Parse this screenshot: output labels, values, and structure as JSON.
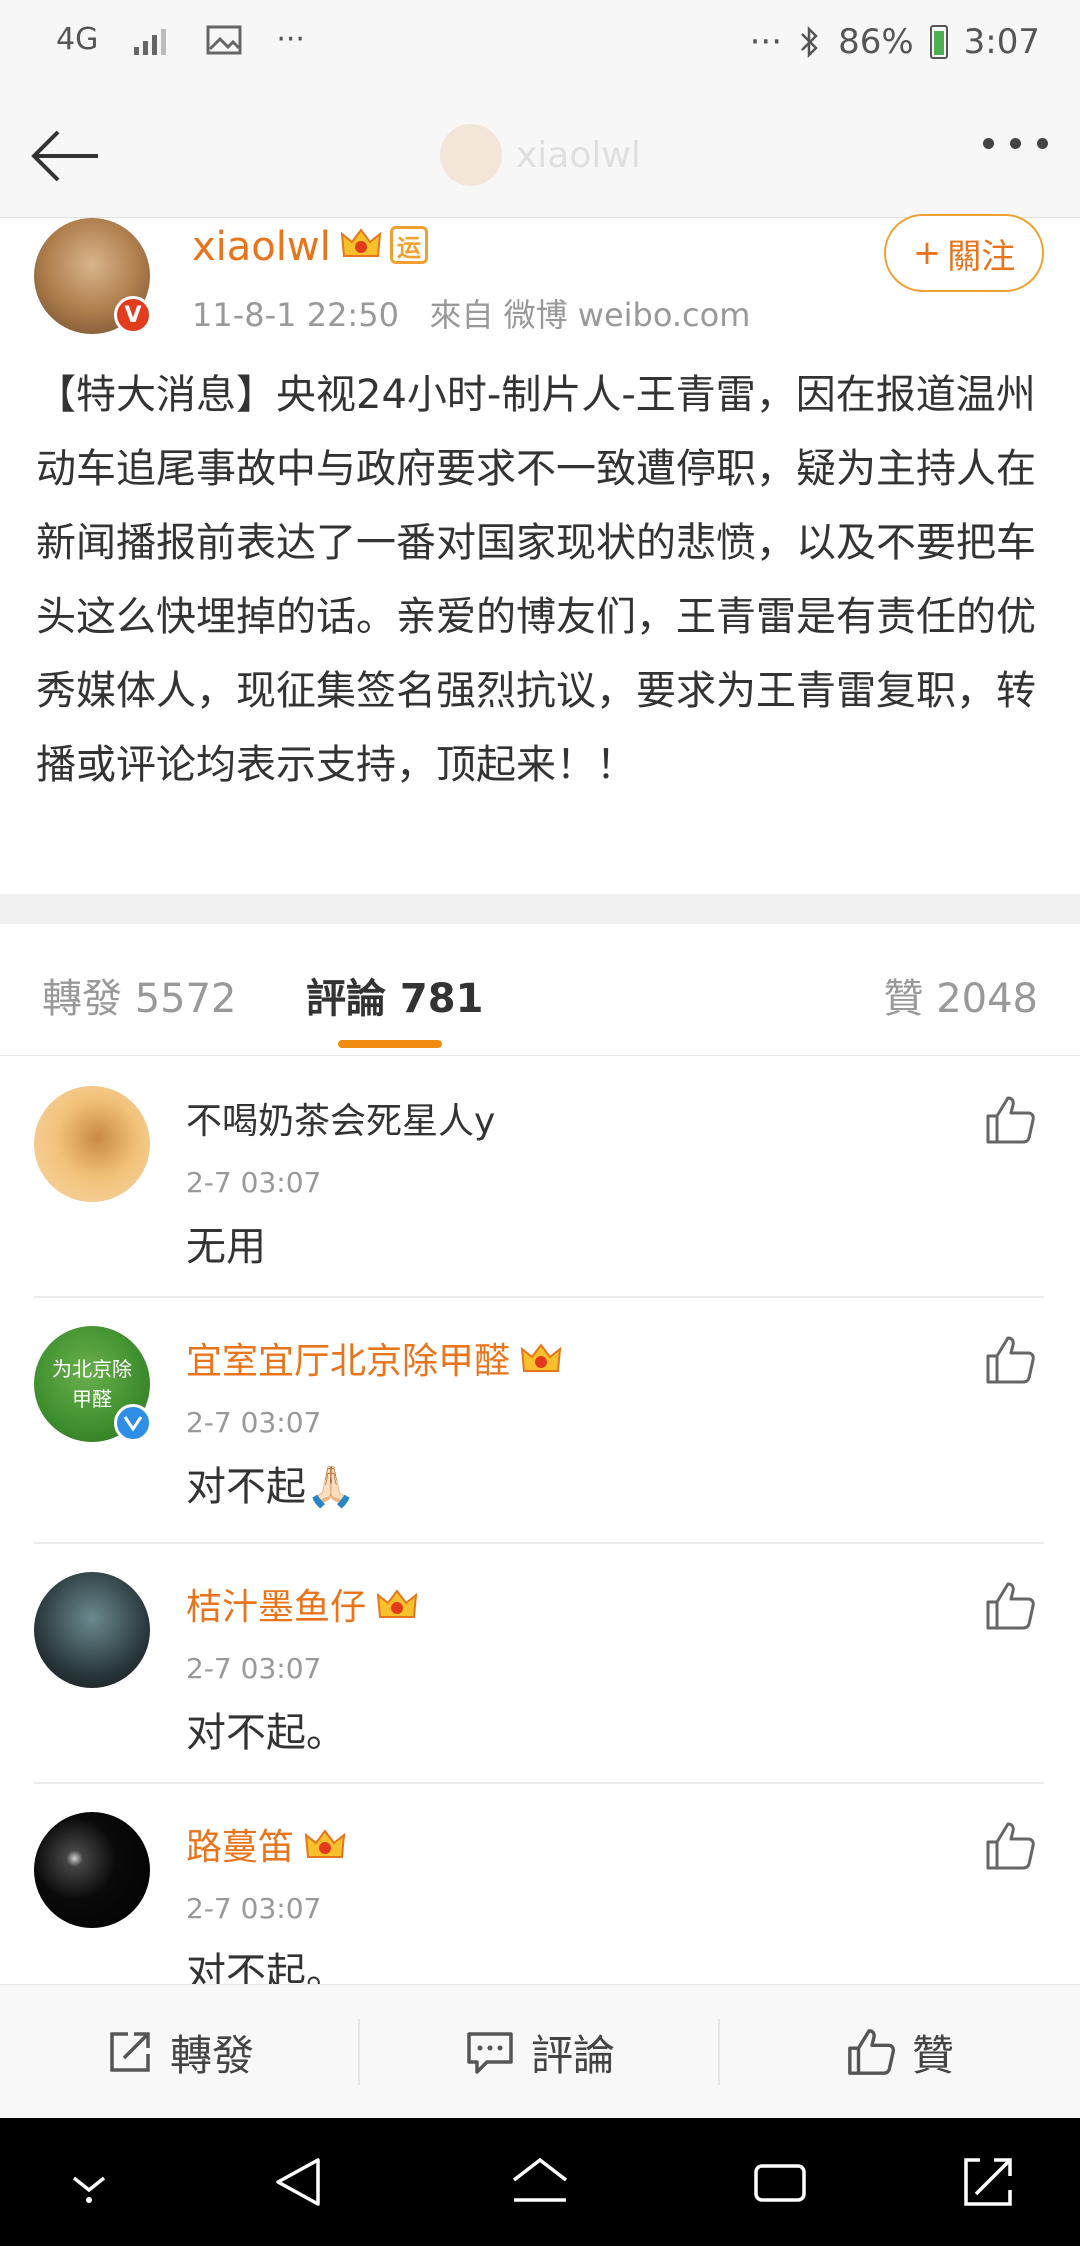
{
  "status_bar": {
    "network": "4G",
    "more_left": "···",
    "more_right": "···",
    "battery": "86%",
    "time": "3:07"
  },
  "nav": {
    "ghost_title": "xiaolwl"
  },
  "post": {
    "author": "xiaolwl",
    "badge_yun": "运",
    "verified_badge": "V",
    "time": "11-8-1 22:50",
    "source": "來自 微博 weibo.com",
    "follow_label": "關注",
    "follow_plus": "+",
    "content": "【特大消息】央视24小时-制片人-王青雷，因在报道温州动车追尾事故中与政府要求不一致遭停职，疑为主持人在新闻播报前表达了一番对国家现状的悲愤，以及不要把车头这么快埋掉的话。亲爱的博友们，王青雷是有责任的优秀媒体人，现征集签名强烈抗议，要求为王青雷复职，转播或评论均表示支持，顶起来！！"
  },
  "tabs": {
    "repost": "轉發 5572",
    "comments": "評論 781",
    "likes": "贊 2048"
  },
  "comments": [
    {
      "name": "不喝奶茶会死星人y",
      "time": "2-7 03:07",
      "text": "无用"
    },
    {
      "name": "宜室宜厅北京除甲醛",
      "time": "2-7 03:07",
      "text": "对不起🙏🏻",
      "avatar_text": "为北京除甲醛"
    },
    {
      "name": "桔汁墨鱼仔",
      "time": "2-7 03:07",
      "text": "对不起。"
    },
    {
      "name": "路蔓笛",
      "time": "2-7 03:07",
      "text": "对不起。"
    }
  ],
  "action_bar": {
    "repost": "轉發",
    "comment": "評論",
    "like": "贊"
  },
  "colors": {
    "accent": "#e8741c",
    "tab_underline": "#f08c12",
    "verified_red": "#e23c1d",
    "verified_blue": "#2f8fe6"
  }
}
